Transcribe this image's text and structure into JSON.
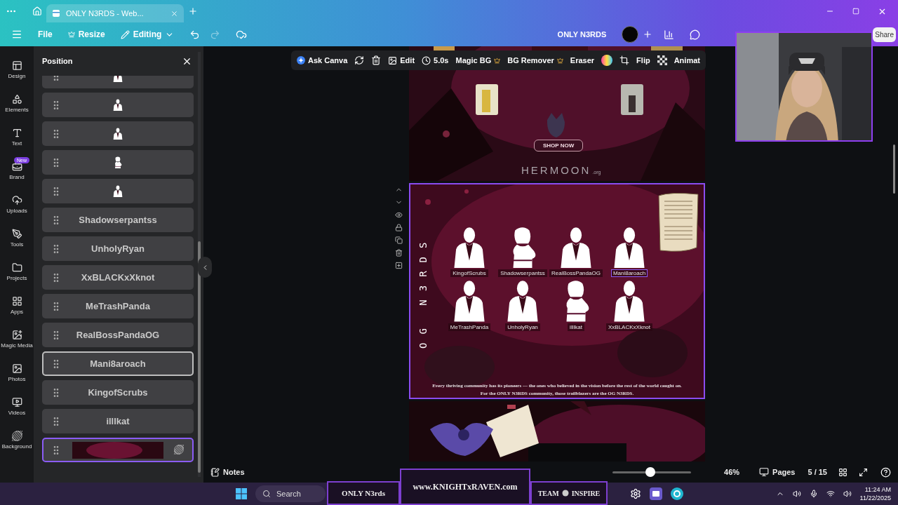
{
  "browser": {
    "tab_title": "ONLY N3RDS - Web..."
  },
  "menu_bar": {
    "items": [
      {
        "label": "File",
        "kind": "plain"
      },
      {
        "label": "Resize",
        "kind": "crown"
      },
      {
        "label": "Editing",
        "kind": "dropdown"
      }
    ],
    "undo": {
      "disabled": false
    },
    "redo": {
      "disabled": true
    },
    "title": "ONLY N3RDS",
    "share": "Share"
  },
  "rail": [
    {
      "label": "Design"
    },
    {
      "label": "Elements"
    },
    {
      "label": "Text"
    },
    {
      "label": "Brand",
      "badge": "New"
    },
    {
      "label": "Uploads"
    },
    {
      "label": "Tools"
    },
    {
      "label": "Projects"
    },
    {
      "label": "Apps"
    },
    {
      "label": "Magic Media"
    },
    {
      "label": "Photos"
    },
    {
      "label": "Videos"
    },
    {
      "label": "Background"
    }
  ],
  "layers": {
    "title": "Position",
    "items": [
      {
        "kind": "man",
        "selected": false,
        "hovered": false
      },
      {
        "kind": "man",
        "selected": false,
        "hovered": false
      },
      {
        "kind": "man",
        "selected": false,
        "hovered": false
      },
      {
        "kind": "woman",
        "selected": false,
        "hovered": false
      },
      {
        "kind": "man",
        "selected": false,
        "hovered": false
      },
      {
        "kind": "text",
        "label": "Shadowserpantss",
        "selected": false,
        "hovered": false
      },
      {
        "kind": "text",
        "label": "UnholyRyan",
        "selected": false,
        "hovered": false
      },
      {
        "kind": "text",
        "label": "XxBLACKxXknot",
        "selected": false,
        "hovered": false
      },
      {
        "kind": "text",
        "label": "MeTrashPanda",
        "selected": false,
        "hovered": false
      },
      {
        "kind": "text",
        "label": "RealBossPandaOG",
        "selected": false,
        "hovered": false
      },
      {
        "kind": "text",
        "label": "Mani8aroach",
        "selected": false,
        "hovered": true
      },
      {
        "kind": "text",
        "label": "KingofScrubs",
        "selected": false,
        "hovered": false
      },
      {
        "kind": "text",
        "label": "illlkat",
        "selected": false,
        "hovered": false
      },
      {
        "kind": "background",
        "selected": true,
        "hovered": false
      }
    ]
  },
  "toolbar": [
    {
      "kind": "button",
      "label": "Ask Canva",
      "premium": false
    },
    {
      "kind": "icon"
    },
    {
      "kind": "icon"
    },
    {
      "kind": "button",
      "label": "Edit",
      "premium": false
    },
    {
      "kind": "button",
      "label": "5.0s",
      "premium": false
    },
    {
      "kind": "button",
      "label": "Magic BG",
      "premium": true
    },
    {
      "kind": "button",
      "label": "BG Remover",
      "premium": true
    },
    {
      "kind": "button",
      "label": "Eraser",
      "premium": false
    },
    {
      "kind": "color"
    },
    {
      "kind": "icon"
    },
    {
      "kind": "button",
      "label": "Flip",
      "premium": false
    },
    {
      "kind": "icon"
    },
    {
      "kind": "button",
      "label": "Animat",
      "premium": false
    }
  ],
  "pages": [
    {
      "kind": "shop",
      "selected": false,
      "shop_button": "SHOP NOW",
      "logo": "HERMOON",
      "logo_suffix": ".org"
    },
    {
      "kind": "members",
      "selected": true,
      "side_title": "OG N3RDS",
      "members": [
        {
          "name": "KingofScrubs",
          "kind": "man",
          "selected": false
        },
        {
          "name": "Shadowserpantss",
          "kind": "woman",
          "selected": false
        },
        {
          "name": "RealBossPandaOG",
          "kind": "man",
          "selected": false
        },
        {
          "name": "Mani8aroach",
          "kind": "man",
          "selected": true
        },
        {
          "name": "MeTrashPanda",
          "kind": "man",
          "selected": false
        },
        {
          "name": "UnholyRyan",
          "kind": "man",
          "selected": false
        },
        {
          "name": "illlkat",
          "kind": "woman",
          "selected": false
        },
        {
          "name": "XxBLACKxXknot",
          "kind": "man",
          "selected": false
        }
      ],
      "caption": [
        "Every thriving community has its pioneers — the ones who believed in the vision before the rest of the world caught on.",
        "For the ONLY N3RDS community, those trailblazers are the OG N3RDS."
      ]
    },
    {
      "kind": "raven",
      "selected": false
    }
  ],
  "bottom_bar": {
    "notes": "Notes",
    "zoom": {
      "level": 0.48,
      "reading": "46%"
    },
    "pages": "Pages",
    "page_count": "5 / 15"
  },
  "stream_overlay": {
    "left": "ONLY N3rds",
    "center": "www.KNIGHTxRAVEN.com",
    "right_a": "TEAM",
    "right_b": "INSPIRE"
  },
  "taskbar": {
    "search": "Search",
    "time": "11:24 AM",
    "date": "11/22/2025"
  }
}
